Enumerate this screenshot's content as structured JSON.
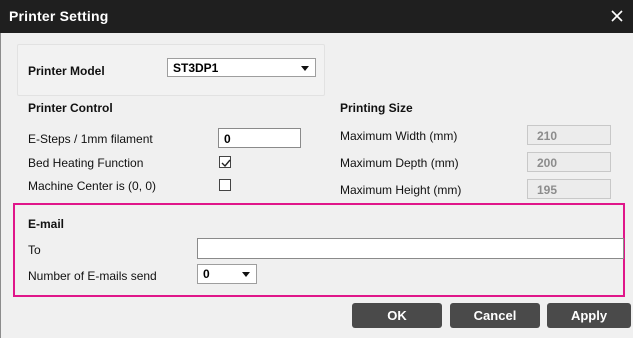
{
  "window": {
    "title": "Printer Setting",
    "close_glyph": "✕"
  },
  "printer_model": {
    "label": "Printer Model",
    "selected": "ST3DP1"
  },
  "printer_control": {
    "heading": "Printer Control",
    "esteps_label": "E-Steps / 1mm filament",
    "esteps_value": "0",
    "bed_heating_label": "Bed Heating Function",
    "bed_heating_checked": true,
    "machine_center_label": "Machine Center is (0, 0)",
    "machine_center_checked": false
  },
  "printing_size": {
    "heading": "Printing Size",
    "max_width_label": "Maximum Width (mm)",
    "max_width_value": "210",
    "max_depth_label": "Maximum Depth (mm)",
    "max_depth_value": "200",
    "max_height_label": "Maximum Height (mm)",
    "max_height_value": "195"
  },
  "email": {
    "heading": "E-mail",
    "to_label": "To",
    "to_value": "",
    "count_label": "Number of E-mails send",
    "count_selected": "0"
  },
  "buttons": {
    "ok": "OK",
    "cancel": "Cancel",
    "apply": "Apply"
  },
  "colors": {
    "titlebar": "#1f1f1f",
    "highlight": "#e0168a",
    "button": "#4a4a4a"
  },
  "icons": {
    "close": "close-icon",
    "dropdown": "chevron-down-icon",
    "check": "checkmark-icon"
  }
}
